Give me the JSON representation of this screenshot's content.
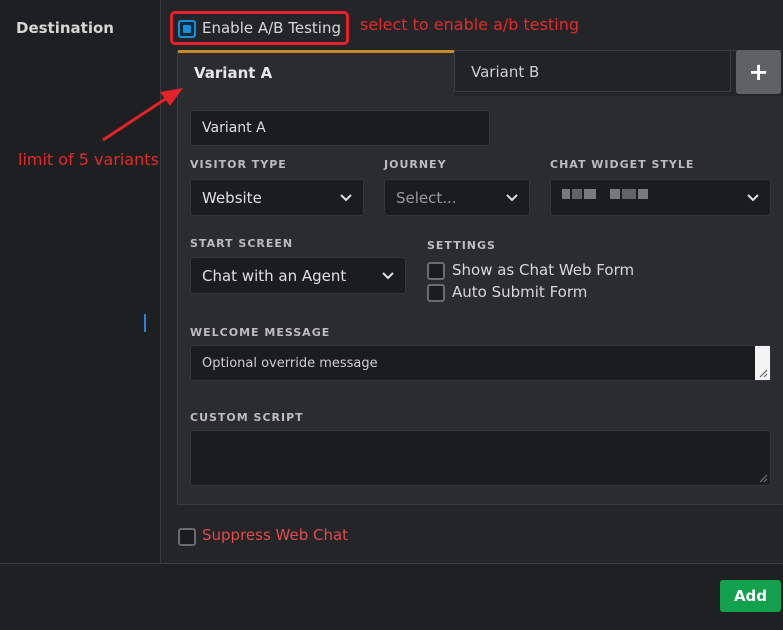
{
  "left": {
    "destination_label": "Destination"
  },
  "abtest": {
    "label": "Enable A/B Testing",
    "checked": true
  },
  "annotations": {
    "select_hint": "select to enable a/b testing",
    "limit_hint": "limit of 5 variants",
    "color": "#e3222a"
  },
  "tabs": [
    {
      "label": "Variant A",
      "active": true
    },
    {
      "label": "Variant B",
      "active": false
    }
  ],
  "add_tab": {
    "label": "+"
  },
  "variant_name": {
    "value": "Variant A"
  },
  "visitor_type": {
    "label": "VISITOR TYPE",
    "value": "Website"
  },
  "journey": {
    "label": "JOURNEY",
    "value": "Select..."
  },
  "chat_widget_style": {
    "label": "CHAT WIDGET STYLE"
  },
  "start_screen": {
    "label": "START SCREEN",
    "value": "Chat with an Agent"
  },
  "settings": {
    "label": "SETTINGS",
    "options": [
      {
        "label": "Show as Chat Web Form",
        "checked": false
      },
      {
        "label": "Auto Submit Form",
        "checked": false
      }
    ]
  },
  "welcome_message": {
    "label": "WELCOME MESSAGE",
    "placeholder": "Optional override message"
  },
  "custom_script": {
    "label": "CUSTOM SCRIPT",
    "value": ""
  },
  "suppress": {
    "label": "Suppress Web Chat",
    "checked": false
  },
  "footer": {
    "add_label": "Add"
  },
  "colors": {
    "accent_tab": "#c98a2a",
    "add_button": "#13a14d",
    "checkbox_active": "#1a8fd8"
  }
}
